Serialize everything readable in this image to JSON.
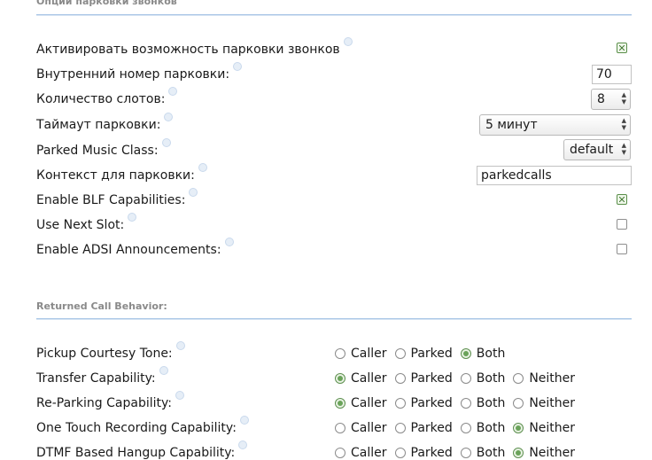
{
  "parking_section": {
    "title": "Опции парковки звонков",
    "enable_parking": {
      "label": "Активировать возможность парковки звонков",
      "checked": true
    },
    "ext_number": {
      "label": "Внутренний номер парковки:",
      "value": "70"
    },
    "slots": {
      "label": "Количество слотов:",
      "value": "8"
    },
    "timeout": {
      "label": "Таймаут парковки:",
      "value": "5 минут"
    },
    "music_class": {
      "label": "Parked Music Class:",
      "value": "default"
    },
    "context": {
      "label": "Контекст для парковки:",
      "value": "parkedcalls"
    },
    "blf": {
      "label": "Enable BLF Capabilities:",
      "checked": true
    },
    "next_slot": {
      "label": "Use Next Slot:",
      "checked": false
    },
    "adsi": {
      "label": "Enable ADSI Announcements:",
      "checked": false
    }
  },
  "returned_section": {
    "title": "Returned Call Behavior:",
    "rows": [
      {
        "label": "Pickup Courtesy Tone:",
        "options": [
          "Caller",
          "Parked",
          "Both"
        ],
        "selected": "Both"
      },
      {
        "label": "Transfer Capability:",
        "options": [
          "Caller",
          "Parked",
          "Both",
          "Neither"
        ],
        "selected": "Caller"
      },
      {
        "label": "Re-Parking Capability:",
        "options": [
          "Caller",
          "Parked",
          "Both",
          "Neither"
        ],
        "selected": "Caller"
      },
      {
        "label": "One Touch Recording Capability:",
        "options": [
          "Caller",
          "Parked",
          "Both",
          "Neither"
        ],
        "selected": "Neither"
      },
      {
        "label": "DTMF Based Hangup Capability:",
        "options": [
          "Caller",
          "Parked",
          "Both",
          "Neither"
        ],
        "selected": "Neither"
      }
    ]
  },
  "colors": {
    "accent_rule": "#a9c6e6",
    "check_green": "#4b7f3b",
    "section_title": "#8a8a8a"
  }
}
